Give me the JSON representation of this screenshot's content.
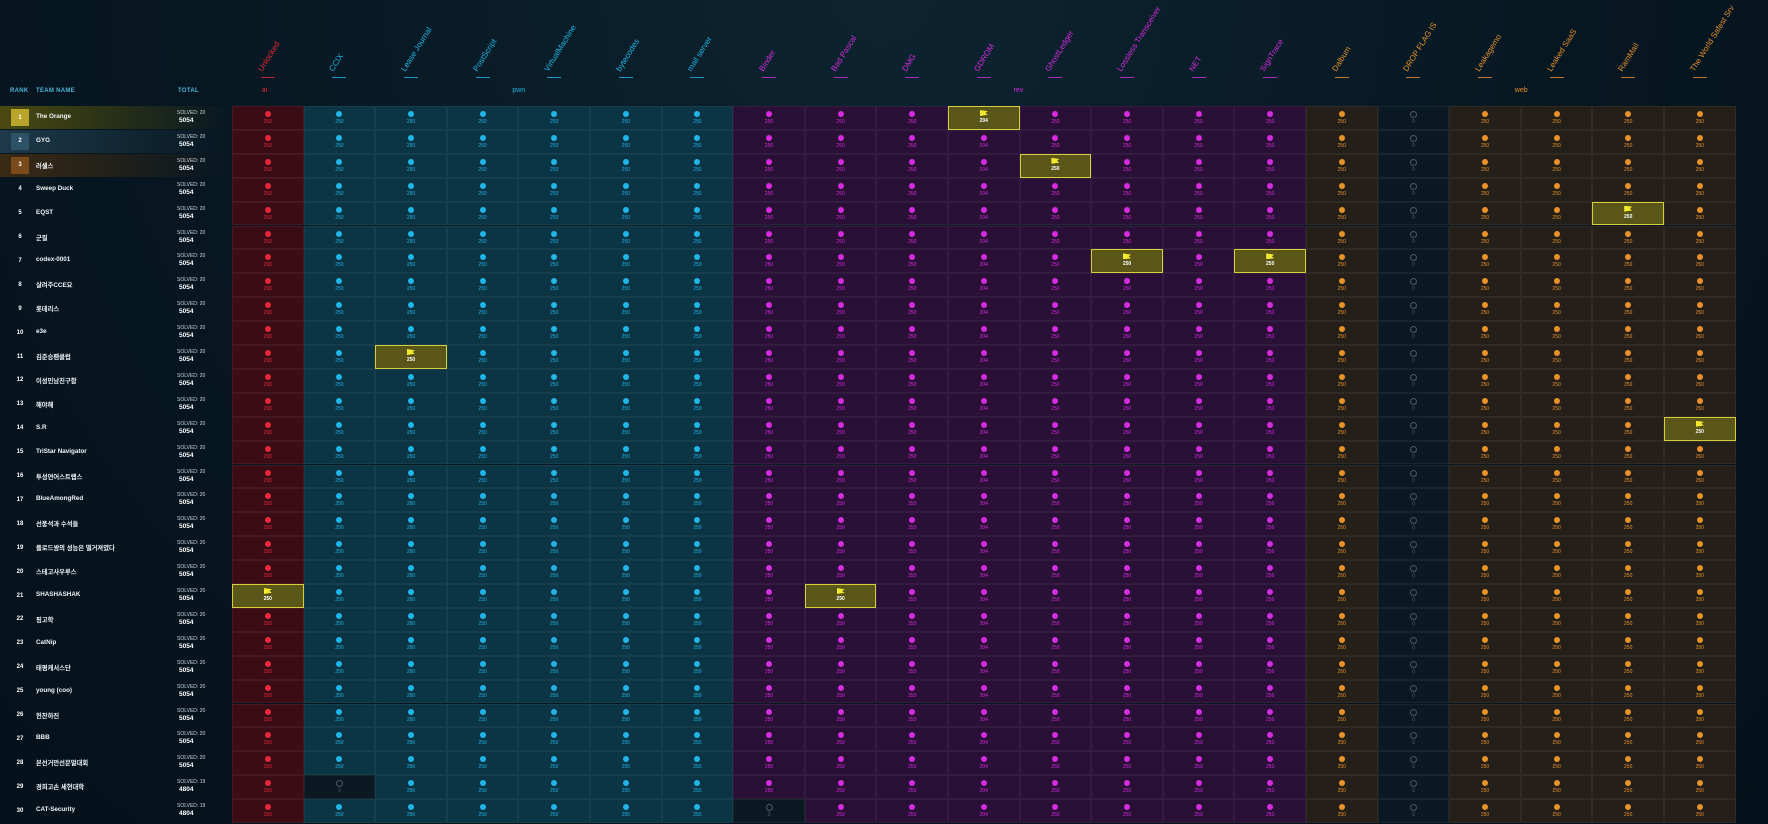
{
  "headers": {
    "rank": "RANK",
    "team": "TEAM NAME",
    "total": "TOTAL",
    "solved_prefix": "SOLVED:"
  },
  "colors": {
    "ai": "#e8283a",
    "pwn": "#22b6e8",
    "rev": "#d62ce0",
    "web": "#e8922a",
    "first_blood": "#f2ea2e",
    "ai_bg": "#3a0d16",
    "pwn_bg": "#0b3444",
    "rev_bg": "#2a0f36",
    "web_bg": "#251f1a",
    "hl_row": "#4a4a10"
  },
  "categories": [
    {
      "name": "ai",
      "count": 1
    },
    {
      "name": "pwn",
      "count": 6
    },
    {
      "name": "rev",
      "count": 8
    },
    {
      "name": "web",
      "count": 6
    }
  ],
  "challenges": [
    {
      "name": "Unlocked",
      "cat": "ai"
    },
    {
      "name": "CCIX",
      "cat": "pwn"
    },
    {
      "name": "Lease Journal",
      "cat": "pwn"
    },
    {
      "name": "PostScript",
      "cat": "pwn"
    },
    {
      "name": "VirtualMachine",
      "cat": "pwn"
    },
    {
      "name": "bytecodes",
      "cat": "pwn"
    },
    {
      "name": "mail server",
      "cat": "pwn"
    },
    {
      "name": "Binder",
      "cat": "rev"
    },
    {
      "name": "Bad Pascal",
      "cat": "rev"
    },
    {
      "name": "DMG",
      "cat": "rev"
    },
    {
      "name": "GDROM",
      "cat": "rev"
    },
    {
      "name": "GhostLedger",
      "cat": "rev"
    },
    {
      "name": "Lossless Transceiver",
      "cat": "rev"
    },
    {
      "name": "NET",
      "cat": "rev"
    },
    {
      "name": "SignTrace",
      "cat": "rev"
    },
    {
      "name": "Dalbum",
      "cat": "web"
    },
    {
      "name": "DROP FLAG IS",
      "cat": "web"
    },
    {
      "name": "Leakagemo",
      "cat": "web"
    },
    {
      "name": "Leaked SaaS",
      "cat": "web"
    },
    {
      "name": "RamMail",
      "cat": "web"
    },
    {
      "name": "The World Safest Srv",
      "cat": "web"
    }
  ],
  "points": [
    250,
    250,
    250,
    250,
    250,
    250,
    250,
    250,
    250,
    250,
    204,
    250,
    250,
    250,
    250,
    250,
    0,
    250,
    250,
    250,
    250
  ],
  "teams": [
    {
      "rank": "1",
      "name": "The Orange",
      "solved": "SOLVED: 20",
      "score": "5054",
      "fb": [
        10
      ]
    },
    {
      "rank": "2",
      "name": "GYG",
      "solved": "SOLVED: 20",
      "score": "5054",
      "fb": []
    },
    {
      "rank": "3",
      "name": "러셀스",
      "solved": "SOLVED: 20",
      "score": "5054",
      "fb": [
        11
      ]
    },
    {
      "rank": "4",
      "name": "Sweep Duck",
      "solved": "SOLVED: 20",
      "score": "5054",
      "fb": []
    },
    {
      "rank": "5",
      "name": "EQST",
      "solved": "SOLVED: 20",
      "score": "5054",
      "fb": [
        19
      ]
    },
    {
      "rank": "6",
      "name": "군필",
      "solved": "SOLVED: 20",
      "score": "5054",
      "fb": []
    },
    {
      "rank": "7",
      "name": "codex-0001",
      "solved": "SOLVED: 20",
      "score": "5054",
      "fb": [
        12,
        14
      ]
    },
    {
      "rank": "8",
      "name": "살려주CCE요",
      "solved": "SOLVED: 20",
      "score": "5054",
      "fb": []
    },
    {
      "rank": "9",
      "name": "롯데리스",
      "solved": "SOLVED: 20",
      "score": "5054",
      "fb": []
    },
    {
      "rank": "10",
      "name": "e3e",
      "solved": "SOLVED: 20",
      "score": "5054",
      "fb": []
    },
    {
      "rank": "11",
      "name": "김준승팬클럽",
      "solved": "SOLVED: 20",
      "score": "5054",
      "fb": [
        2
      ]
    },
    {
      "rank": "12",
      "name": "이성민남친구함",
      "solved": "SOLVED: 20",
      "score": "5054",
      "fb": []
    },
    {
      "rank": "13",
      "name": "해야해",
      "solved": "SOLVED: 20",
      "score": "5054",
      "fb": []
    },
    {
      "rank": "14",
      "name": "S.R",
      "solved": "SOLVED: 20",
      "score": "5054",
      "fb": [
        20
      ]
    },
    {
      "rank": "15",
      "name": "TriStar Navigator",
      "solved": "SOLVED: 20",
      "score": "5054",
      "fb": []
    },
    {
      "rank": "16",
      "name": "투성연어스트랩스",
      "solved": "SOLVED: 20",
      "score": "5054",
      "fb": []
    },
    {
      "rank": "17",
      "name": "BlueAmongRed",
      "solved": "SOLVED: 20",
      "score": "5054",
      "fb": []
    },
    {
      "rank": "18",
      "name": "선풍석과 수석들",
      "solved": "SOLVED: 20",
      "score": "5054",
      "fb": []
    },
    {
      "rank": "19",
      "name": "플로드쌍의 성능은 떨거져였다",
      "solved": "SOLVED: 20",
      "score": "5054",
      "fb": []
    },
    {
      "rank": "20",
      "name": "스테고사우루스",
      "solved": "SOLVED: 20",
      "score": "5054",
      "fb": []
    },
    {
      "rank": "21",
      "name": "SHASHASHAK",
      "solved": "SOLVED: 20",
      "score": "5054",
      "fb": [
        0,
        8
      ]
    },
    {
      "rank": "22",
      "name": "핑고학",
      "solved": "SOLVED: 20",
      "score": "5054",
      "fb": []
    },
    {
      "rank": "23",
      "name": "CatNip",
      "solved": "SOLVED: 20",
      "score": "5054",
      "fb": []
    },
    {
      "rank": "24",
      "name": "태평캐서스단",
      "solved": "SOLVED: 20",
      "score": "5054",
      "fb": []
    },
    {
      "rank": "25",
      "name": "young (coo)",
      "solved": "SOLVED: 20",
      "score": "5054",
      "fb": []
    },
    {
      "rank": "26",
      "name": "헌찬하진",
      "solved": "SOLVED: 20",
      "score": "5054",
      "fb": []
    },
    {
      "rank": "27",
      "name": "BBB",
      "solved": "SOLVED: 20",
      "score": "5054",
      "fb": []
    },
    {
      "rank": "28",
      "name": "본선거만선문멀대회",
      "solved": "SOLVED: 20",
      "score": "5054",
      "fb": []
    },
    {
      "rank": "29",
      "name": "경희고손 세현대학",
      "solved": "SOLVED: 19",
      "score": "4804",
      "fb": [],
      "unsolved": [
        1
      ]
    },
    {
      "rank": "30",
      "name": "CAT-Security",
      "solved": "SOLVED: 19",
      "score": "4804",
      "fb": [],
      "unsolved": [
        7
      ]
    }
  ]
}
